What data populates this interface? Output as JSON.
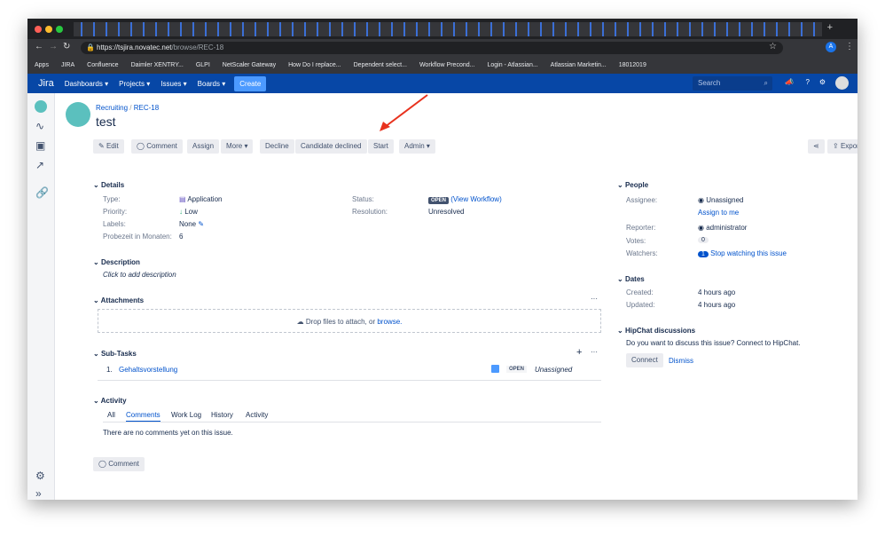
{
  "browser": {
    "url_host": "https://tsjira.novatec.net",
    "url_path": "/browse/REC-18",
    "profile": "A",
    "bookmarks": [
      "Apps",
      "JIRA",
      "Confluence",
      "Daimler XENTRY...",
      "GLPI",
      "NetScaler Gateway",
      "How Do I replace...",
      "Dependent select...",
      "Workflow Precond...",
      "Login - Atlassian...",
      "Atlassian Marketin...",
      "18012019"
    ]
  },
  "nav": {
    "logo": "Jira",
    "items": [
      "Dashboards",
      "Projects",
      "Issues",
      "Boards"
    ],
    "create": "Create",
    "search_placeholder": "Search"
  },
  "issue": {
    "project": "Recruiting",
    "key": "REC-18",
    "title": "test"
  },
  "toolbar": {
    "edit": "Edit",
    "comment": "Comment",
    "assign": "Assign",
    "more": "More",
    "decline": "Decline",
    "candidate_declined": "Candidate declined",
    "start": "Start",
    "admin": "Admin",
    "export": "Export"
  },
  "details": {
    "heading": "Details",
    "type_label": "Type:",
    "type": "Application",
    "priority_label": "Priority:",
    "priority": "Low",
    "labels_label": "Labels:",
    "labels": "None",
    "probezeit_label": "Probezeit in Monaten:",
    "probezeit": "6",
    "status_label": "Status:",
    "status": "OPEN",
    "view_workflow": "(View Workflow)",
    "resolution_label": "Resolution:",
    "resolution": "Unresolved"
  },
  "description": {
    "heading": "Description",
    "placeholder": "Click to add description"
  },
  "attachments": {
    "heading": "Attachments",
    "drop": "Drop files to attach, or",
    "browse": "browse."
  },
  "subtasks": {
    "heading": "Sub-Tasks",
    "items": [
      {
        "num": "1.",
        "name": "Gehaltsvorstellung",
        "status": "OPEN",
        "assignee": "Unassigned"
      }
    ]
  },
  "activity": {
    "heading": "Activity",
    "tabs": [
      "All",
      "Comments",
      "Work Log",
      "History",
      "Activity"
    ],
    "empty": "There are no comments yet on this issue.",
    "comment_button": "Comment"
  },
  "people": {
    "heading": "People",
    "assignee_label": "Assignee:",
    "assignee": "Unassigned",
    "assign_to_me": "Assign to me",
    "reporter_label": "Reporter:",
    "reporter": "administrator",
    "votes_label": "Votes:",
    "votes": "0",
    "watchers_label": "Watchers:",
    "watchers": "1",
    "stop_watching": "Stop watching this issue"
  },
  "dates": {
    "heading": "Dates",
    "created_label": "Created:",
    "created": "4 hours ago",
    "updated_label": "Updated:",
    "updated": "4 hours ago"
  },
  "hipchat": {
    "heading": "HipChat discussions",
    "text": "Do you want to discuss this issue? Connect to HipChat.",
    "connect": "Connect",
    "dismiss": "Dismiss"
  }
}
